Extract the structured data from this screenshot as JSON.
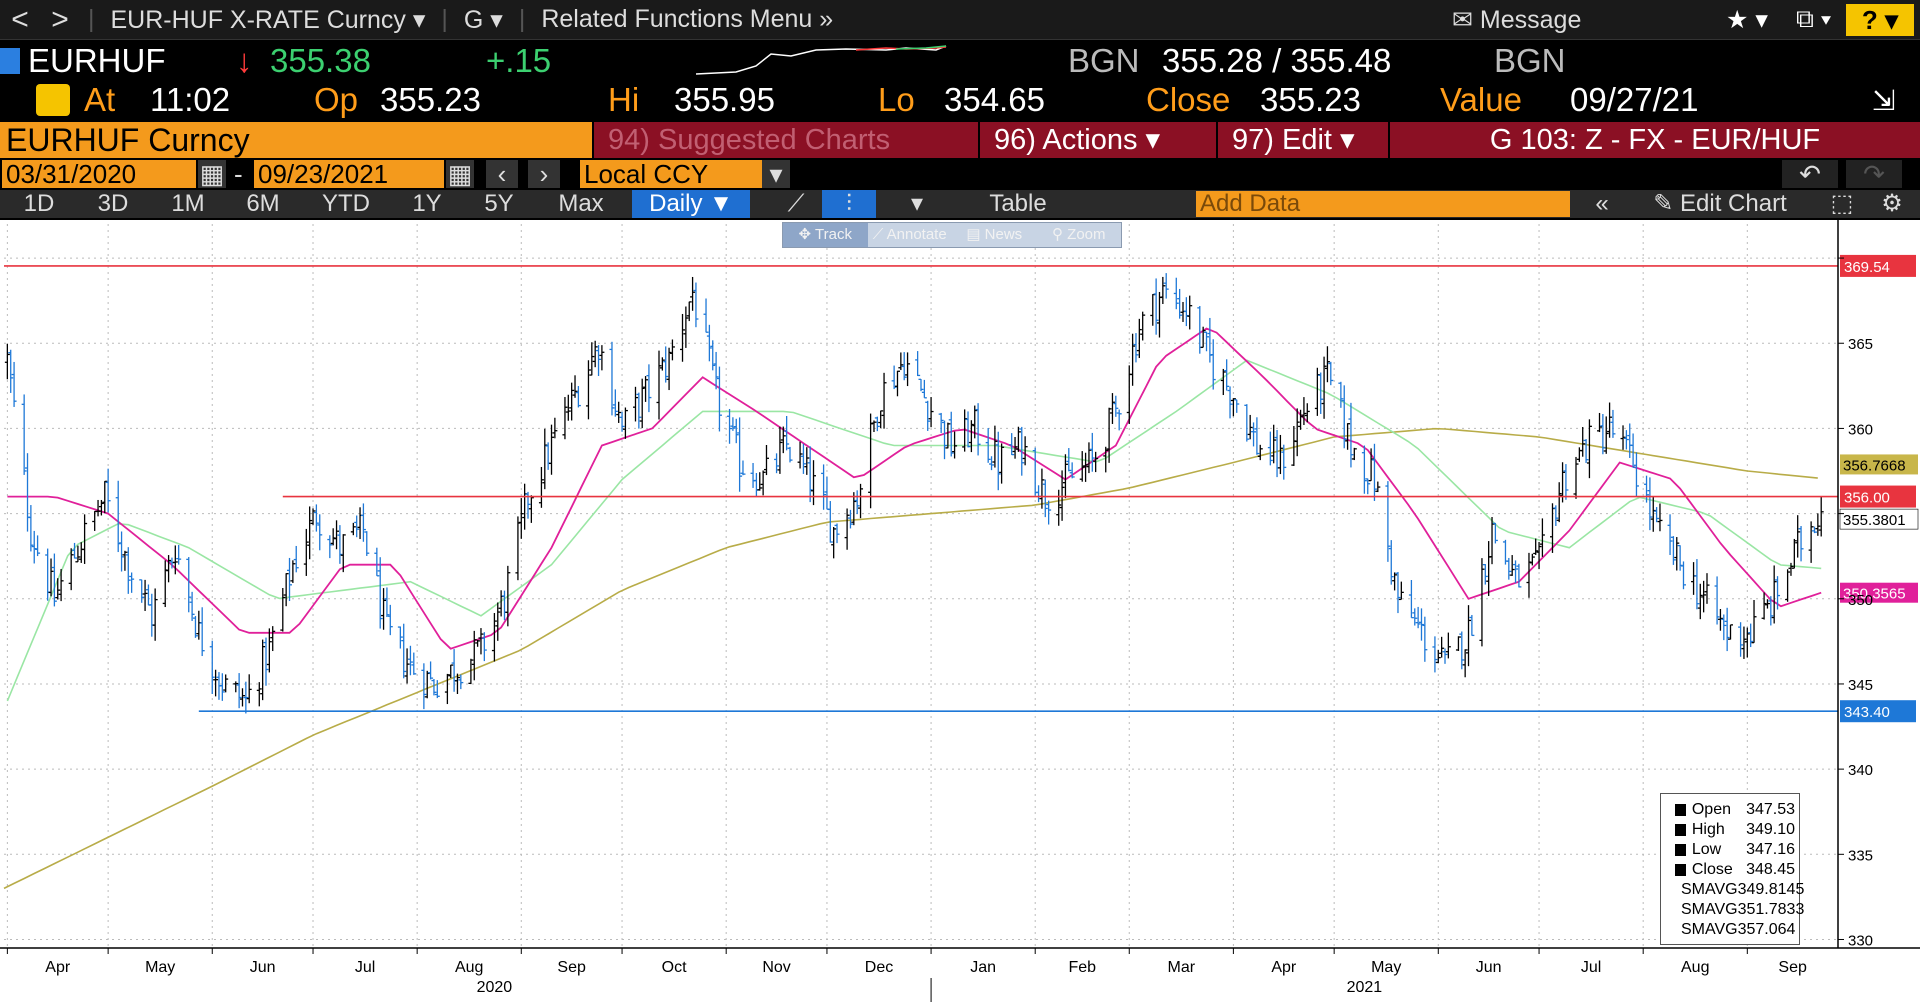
{
  "toolbar": {
    "back": "<",
    "forward": ">",
    "security": "EUR-HUF X-RATE Curncy",
    "function": "G",
    "related": "Related Functions Menu",
    "message": "Message",
    "help": "?"
  },
  "ticker": {
    "symbol": "EURHUF",
    "last": "355.38",
    "change": "+.15",
    "bgn_left": "BGN",
    "bid_ask": "355.28 / 355.48",
    "bgn_right": "BGN"
  },
  "quote": {
    "at_label": "At",
    "time": "11:02",
    "op_label": "Op",
    "open": "355.23",
    "hi_label": "Hi",
    "high": "355.95",
    "lo_label": "Lo",
    "low": "354.65",
    "close_label": "Close",
    "close": "355.23",
    "value_label": "Value",
    "value_date": "09/27/21"
  },
  "titlebar": {
    "title": "EURHUF Curncy",
    "suggested": "94) Suggested Charts",
    "actions": "96) Actions",
    "edit": "97) Edit",
    "page": "G 103: Z - FX - EUR/HUF"
  },
  "range": {
    "start": "03/31/2020",
    "dash": "-",
    "end": "09/23/2021",
    "currency": "Local CCY"
  },
  "periods": [
    "1D",
    "3D",
    "1M",
    "6M",
    "YTD",
    "1Y",
    "5Y",
    "Max"
  ],
  "frequency": "Daily",
  "table_label": "Table",
  "add_data_placeholder": "Add Data",
  "edit_chart": "Edit Chart",
  "chart_tools": [
    "Track",
    "Annotate",
    "News",
    "Zoom"
  ],
  "chart_data": {
    "type": "line",
    "series_style": "ohlc-bars",
    "x_months": [
      "Apr",
      "May",
      "Jun",
      "Jul",
      "Aug",
      "Sep",
      "Oct",
      "Nov",
      "Dec",
      "Jan",
      "Feb",
      "Mar",
      "Apr",
      "May",
      "Jun",
      "Jul",
      "Aug",
      "Sep"
    ],
    "x_years": [
      "2020",
      "2021"
    ],
    "ylim": [
      329.5,
      372
    ],
    "y_ticks": [
      330,
      335,
      340,
      345,
      350,
      355,
      360,
      365,
      370
    ],
    "y_tick_labels": [
      "330",
      "335",
      "340",
      "345",
      "350",
      "",
      "360",
      "365",
      ""
    ],
    "close_points": [
      [
        "2020-04-01",
        364
      ],
      [
        "2020-04-08",
        354
      ],
      [
        "2020-04-15",
        350
      ],
      [
        "2020-04-22",
        353
      ],
      [
        "2020-04-30",
        356
      ],
      [
        "2020-05-07",
        352
      ],
      [
        "2020-05-14",
        349
      ],
      [
        "2020-05-21",
        353
      ],
      [
        "2020-05-28",
        348
      ],
      [
        "2020-06-04",
        345
      ],
      [
        "2020-06-11",
        344
      ],
      [
        "2020-06-18",
        347
      ],
      [
        "2020-06-25",
        352
      ],
      [
        "2020-07-02",
        355
      ],
      [
        "2020-07-09",
        353
      ],
      [
        "2020-07-16",
        354
      ],
      [
        "2020-07-23",
        348
      ],
      [
        "2020-07-30",
        346
      ],
      [
        "2020-08-06",
        345
      ],
      [
        "2020-08-13",
        346
      ],
      [
        "2020-08-20",
        347
      ],
      [
        "2020-08-27",
        350
      ],
      [
        "2020-09-03",
        356
      ],
      [
        "2020-09-10",
        359
      ],
      [
        "2020-09-17",
        362
      ],
      [
        "2020-09-24",
        365
      ],
      [
        "2020-10-01",
        360
      ],
      [
        "2020-10-08",
        362
      ],
      [
        "2020-10-15",
        364
      ],
      [
        "2020-10-22",
        368
      ],
      [
        "2020-10-29",
        362
      ],
      [
        "2020-11-05",
        358
      ],
      [
        "2020-11-12",
        357
      ],
      [
        "2020-11-19",
        359
      ],
      [
        "2020-11-26",
        357
      ],
      [
        "2020-12-03",
        354
      ],
      [
        "2020-12-10",
        356
      ],
      [
        "2020-12-17",
        362
      ],
      [
        "2020-12-24",
        364
      ],
      [
        "2021-01-07",
        359
      ],
      [
        "2021-01-14",
        360
      ],
      [
        "2021-01-21",
        358
      ],
      [
        "2021-01-28",
        359
      ],
      [
        "2021-02-04",
        356
      ],
      [
        "2021-02-11",
        357
      ],
      [
        "2021-02-18",
        358
      ],
      [
        "2021-02-25",
        361
      ],
      [
        "2021-03-04",
        366
      ],
      [
        "2021-03-11",
        368
      ],
      [
        "2021-03-18",
        367
      ],
      [
        "2021-03-25",
        364
      ],
      [
        "2021-04-01",
        362
      ],
      [
        "2021-04-08",
        359
      ],
      [
        "2021-04-15",
        358
      ],
      [
        "2021-04-22",
        361
      ],
      [
        "2021-04-29",
        363
      ],
      [
        "2021-05-06",
        359
      ],
      [
        "2021-05-13",
        357
      ],
      [
        "2021-05-20",
        350
      ],
      [
        "2021-05-27",
        348
      ],
      [
        "2021-06-03",
        346
      ],
      [
        "2021-06-10",
        348
      ],
      [
        "2021-06-17",
        354
      ],
      [
        "2021-06-24",
        351
      ],
      [
        "2021-07-01",
        352
      ],
      [
        "2021-07-08",
        357
      ],
      [
        "2021-07-15",
        359
      ],
      [
        "2021-07-22",
        360
      ],
      [
        "2021-07-29",
        358
      ],
      [
        "2021-08-05",
        354
      ],
      [
        "2021-08-12",
        352
      ],
      [
        "2021-08-19",
        350
      ],
      [
        "2021-08-26",
        348
      ],
      [
        "2021-09-02",
        348
      ],
      [
        "2021-09-09",
        350
      ],
      [
        "2021-09-16",
        353
      ],
      [
        "2021-09-23",
        355.4
      ]
    ],
    "sma_fast_points": [
      [
        "2020-04-01",
        356
      ],
      [
        "2020-04-15",
        356
      ],
      [
        "2020-05-01",
        355
      ],
      [
        "2020-05-20",
        352
      ],
      [
        "2020-06-10",
        348
      ],
      [
        "2020-06-25",
        348
      ],
      [
        "2020-07-10",
        352
      ],
      [
        "2020-07-25",
        352
      ],
      [
        "2020-08-10",
        347
      ],
      [
        "2020-08-25",
        348
      ],
      [
        "2020-09-10",
        353
      ],
      [
        "2020-09-25",
        359
      ],
      [
        "2020-10-10",
        360
      ],
      [
        "2020-10-25",
        363
      ],
      [
        "2020-11-10",
        361
      ],
      [
        "2020-11-25",
        359
      ],
      [
        "2020-12-10",
        357
      ],
      [
        "2020-12-25",
        359
      ],
      [
        "2021-01-10",
        360
      ],
      [
        "2021-01-25",
        359
      ],
      [
        "2021-02-10",
        357
      ],
      [
        "2021-02-25",
        359
      ],
      [
        "2021-03-10",
        364
      ],
      [
        "2021-03-25",
        366
      ],
      [
        "2021-04-10",
        363
      ],
      [
        "2021-04-25",
        360
      ],
      [
        "2021-05-10",
        359
      ],
      [
        "2021-05-25",
        355
      ],
      [
        "2021-06-10",
        350
      ],
      [
        "2021-06-25",
        351
      ],
      [
        "2021-07-10",
        354
      ],
      [
        "2021-07-25",
        358
      ],
      [
        "2021-08-10",
        357
      ],
      [
        "2021-08-25",
        353
      ],
      [
        "2021-09-10",
        349.5
      ],
      [
        "2021-09-23",
        350.3565
      ]
    ],
    "sma_mid_points": [
      [
        "2020-04-01",
        344
      ],
      [
        "2020-04-20",
        353
      ],
      [
        "2020-05-05",
        354.5
      ],
      [
        "2020-05-25",
        353
      ],
      [
        "2020-06-20",
        350
      ],
      [
        "2020-07-10",
        350.5
      ],
      [
        "2020-07-30",
        351
      ],
      [
        "2020-08-20",
        349
      ],
      [
        "2020-09-10",
        352
      ],
      [
        "2020-10-01",
        357
      ],
      [
        "2020-10-25",
        361
      ],
      [
        "2020-11-20",
        361
      ],
      [
        "2020-12-20",
        359
      ],
      [
        "2021-01-20",
        359
      ],
      [
        "2021-02-20",
        358
      ],
      [
        "2021-03-15",
        361
      ],
      [
        "2021-04-05",
        364
      ],
      [
        "2021-04-30",
        362
      ],
      [
        "2021-05-25",
        359
      ],
      [
        "2021-06-20",
        354
      ],
      [
        "2021-07-10",
        353
      ],
      [
        "2021-07-30",
        356
      ],
      [
        "2021-08-20",
        355
      ],
      [
        "2021-09-10",
        352
      ],
      [
        "2021-09-23",
        351.7833
      ]
    ],
    "sma_slow_points": [
      [
        "2020-03-31",
        333
      ],
      [
        "2020-05-01",
        336
      ],
      [
        "2020-06-01",
        339
      ],
      [
        "2020-07-01",
        342
      ],
      [
        "2020-08-01",
        344.5
      ],
      [
        "2020-09-01",
        347
      ],
      [
        "2020-10-01",
        350.5
      ],
      [
        "2020-11-01",
        353
      ],
      [
        "2020-12-01",
        354.5
      ],
      [
        "2021-01-01",
        355
      ],
      [
        "2021-02-01",
        355.5
      ],
      [
        "2021-03-01",
        356.5
      ],
      [
        "2021-04-01",
        358
      ],
      [
        "2021-05-01",
        359.5
      ],
      [
        "2021-06-01",
        360
      ],
      [
        "2021-07-01",
        359.5
      ],
      [
        "2021-08-01",
        358.5
      ],
      [
        "2021-09-01",
        357.5
      ],
      [
        "2021-09-23",
        357.064
      ]
    ],
    "h_lines": [
      {
        "value": 369.54,
        "label": "369.54",
        "color": "#e8343f"
      },
      {
        "value": 356.0,
        "label": "356.00",
        "color": "#e8343f"
      },
      {
        "value": 343.4,
        "label": "343.40",
        "color": "#1e78d7"
      }
    ],
    "last_tags": [
      {
        "value": 357.064,
        "label": "356.7668",
        "color": "#c8b64a"
      },
      {
        "value": 355.38,
        "label": "355.3801",
        "color": "#ffffff"
      },
      {
        "value": 350.3565,
        "label": "350.3565",
        "color": "#e0209a"
      }
    ],
    "legend": [
      {
        "label": "Open",
        "value": "347.53",
        "color": "#000000"
      },
      {
        "label": "High",
        "value": "349.10",
        "color": "#000000"
      },
      {
        "label": "Low",
        "value": "347.16",
        "color": "#000000"
      },
      {
        "label": "Close",
        "value": "348.45",
        "color": "#000000"
      },
      {
        "label": "SMAVG",
        "value": "349.8145",
        "color": "#e0209a"
      },
      {
        "label": "SMAVG",
        "value": "351.7833",
        "color": "#7fe08a"
      },
      {
        "label": "SMAVG",
        "value": "357.064",
        "color": "#b0a83a"
      }
    ],
    "colors": {
      "up": "#000000",
      "down": "#1e78d7",
      "sma_fast": "#e0209a",
      "sma_mid": "#9ae6a4",
      "sma_slow": "#b8ac48"
    }
  }
}
